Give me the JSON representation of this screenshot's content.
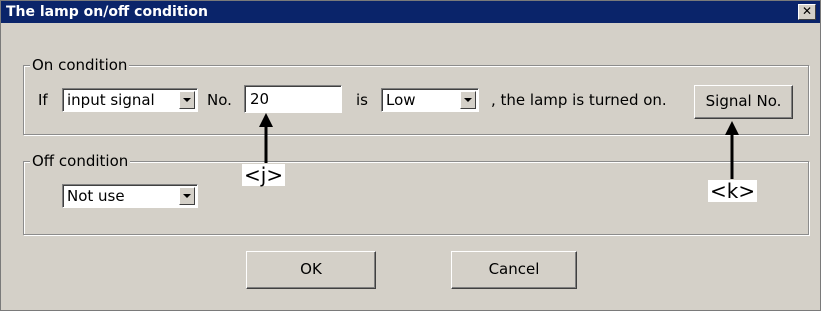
{
  "window": {
    "title": "The lamp on/off condition",
    "close_glyph": "✕"
  },
  "on_condition": {
    "legend": "On condition",
    "if_label": "If",
    "source_value": "input signal",
    "no_label": "No.",
    "number_value": "20",
    "is_label": "is",
    "state_value": "Low",
    "result_text": ", the lamp is turned on.",
    "signal_button": "Signal No."
  },
  "off_condition": {
    "legend": "Off condition",
    "mode_value": "Not use"
  },
  "buttons": {
    "ok": "OK",
    "cancel": "Cancel"
  },
  "annotations": {
    "j": "<j>",
    "k": "<k>"
  }
}
